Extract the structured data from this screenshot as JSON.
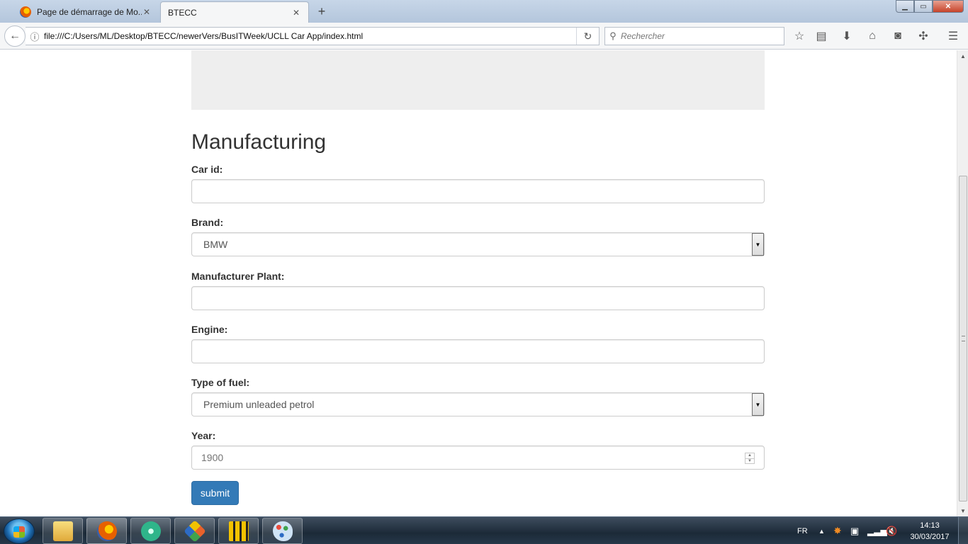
{
  "browser": {
    "tabs": [
      {
        "label": "Page de démarrage de Mo...",
        "close": "✕"
      },
      {
        "label": "BTECC",
        "close": "✕"
      }
    ],
    "new_tab": "+",
    "window_controls": {
      "minimize": "▁",
      "maximize": "▭",
      "close": "✕"
    },
    "back": "←",
    "url": "file:///C:/Users/ML/Desktop/BTECC/newerVers/BusITWeek/UCLL Car App/index.html",
    "info_icon": "ⓘ",
    "reload": "↻",
    "search_placeholder": "Rechercher",
    "search_icon": "⚲",
    "toolbar_icons": [
      "star-icon",
      "reading-list-icon",
      "download-icon",
      "home-icon",
      "pocket-icon",
      "sync-icon",
      "menu-icon"
    ],
    "toolbar_glyphs": [
      "☆",
      "▤",
      "⬇",
      "⌂",
      "◙",
      "✣",
      "☰"
    ]
  },
  "page": {
    "heading": "Manufacturing",
    "form": {
      "car_id": {
        "label": "Car id:",
        "value": ""
      },
      "brand": {
        "label": "Brand:",
        "value": "BMW"
      },
      "plant": {
        "label": "Manufacturer Plant:",
        "value": ""
      },
      "engine": {
        "label": "Engine:",
        "value": ""
      },
      "fuel": {
        "label": "Type of fuel:",
        "value": "Premium unleaded petrol"
      },
      "year": {
        "label": "Year:",
        "placeholder": "1900"
      },
      "submit_label": "submit"
    }
  },
  "taskbar": {
    "language": "FR",
    "time": "14:13",
    "date": "30/03/2017",
    "apps": [
      "file-explorer-icon",
      "firefox-icon",
      "atom-icon",
      "git-extensions-icon",
      "winmerge-icon",
      "paint-icon"
    ],
    "colors": {
      "firefox": "#e66000",
      "atom": "#2fb58a",
      "git": "#e8612b",
      "folder": "#f4c84b",
      "winmerge": "#f2c200",
      "paint": "#5fa0dd"
    }
  }
}
